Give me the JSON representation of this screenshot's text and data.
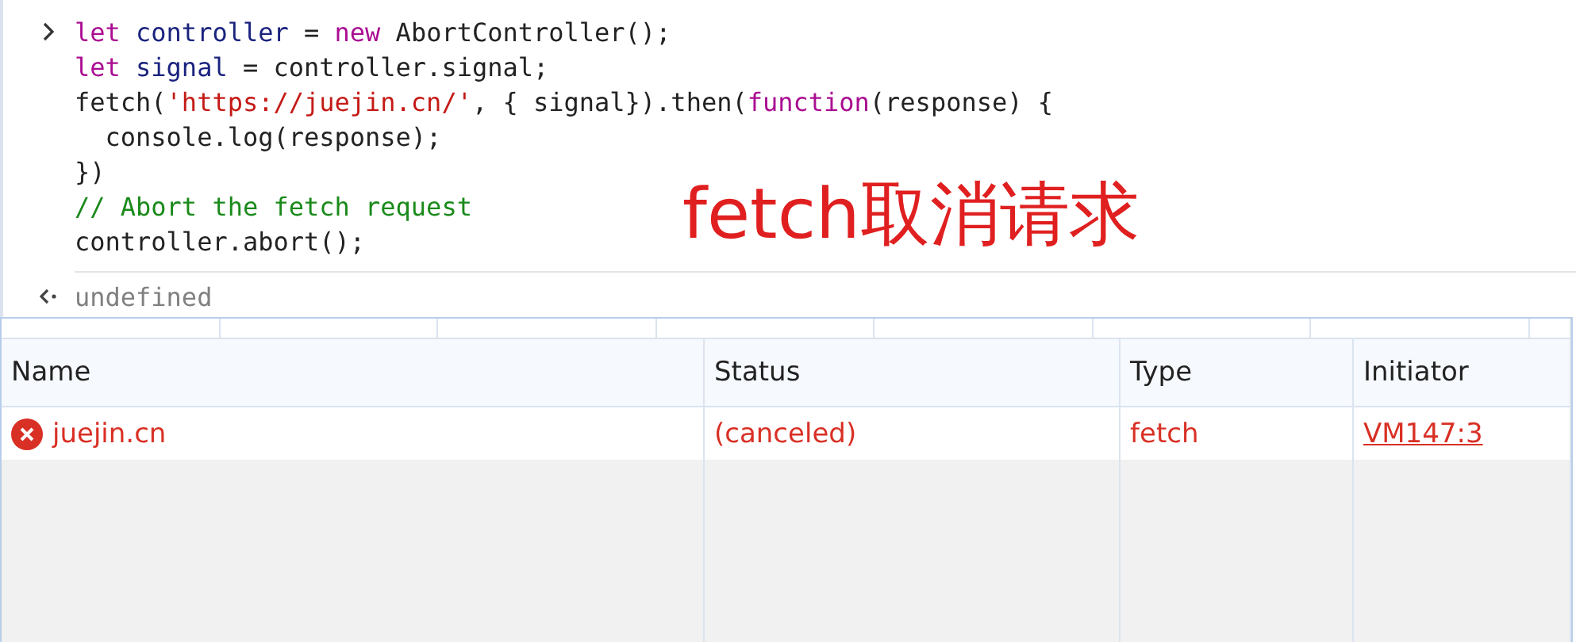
{
  "console": {
    "input_lines": [
      {
        "tokens": [
          {
            "kind": "keyword",
            "text": "let "
          },
          {
            "kind": "variable",
            "text": "controller"
          },
          {
            "kind": "plain",
            "text": " = "
          },
          {
            "kind": "keyword",
            "text": "new"
          },
          {
            "kind": "plain",
            "text": " AbortController();"
          }
        ]
      },
      {
        "tokens": [
          {
            "kind": "keyword",
            "text": "let "
          },
          {
            "kind": "variable",
            "text": "signal"
          },
          {
            "kind": "plain",
            "text": " = controller.signal;"
          }
        ]
      },
      {
        "tokens": [
          {
            "kind": "plain",
            "text": "fetch("
          },
          {
            "kind": "string",
            "text": "'https://juejin.cn/'"
          },
          {
            "kind": "plain",
            "text": ", { signal}).then("
          },
          {
            "kind": "keyword",
            "text": "function"
          },
          {
            "kind": "plain",
            "text": "(response) {"
          }
        ]
      },
      {
        "tokens": [
          {
            "kind": "plain",
            "text": "  console.log(response);"
          }
        ]
      },
      {
        "tokens": [
          {
            "kind": "plain",
            "text": "})"
          }
        ]
      },
      {
        "tokens": [
          {
            "kind": "comment",
            "text": "// Abort the fetch request"
          }
        ]
      },
      {
        "tokens": [
          {
            "kind": "plain",
            "text": "controller.abort();"
          }
        ]
      }
    ],
    "result": "undefined"
  },
  "annotation": "fetch取消请求",
  "network": {
    "columns": [
      "Name",
      "Status",
      "Type",
      "Initiator"
    ],
    "rows": [
      {
        "failed": true,
        "name": "juejin.cn",
        "status": "(canceled)",
        "type": "fetch",
        "initiator": "VM147:3"
      }
    ]
  }
}
